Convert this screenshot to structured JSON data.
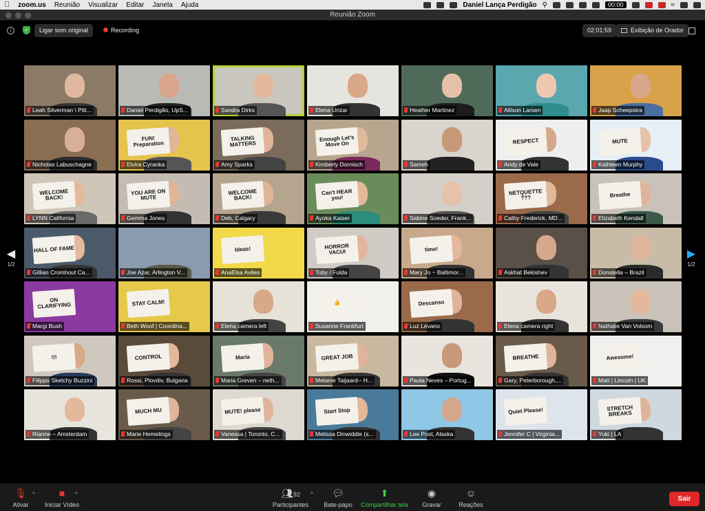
{
  "menubar": {
    "app": "zoom.us",
    "menus": [
      "Reunião",
      "Visualizar",
      "Editar",
      "Janela",
      "Ajuda"
    ],
    "user": "Daniel Lança Perdigão",
    "clock": "00:00"
  },
  "window": {
    "title": "Reunião Zoom"
  },
  "topbar": {
    "audio_label": "Ligar som original",
    "recording_label": "Recording",
    "elapsed": "02:01:59",
    "view_label": "Exibição de Orador"
  },
  "pager": {
    "left": "1/2",
    "right": "1/2"
  },
  "participants": [
    {
      "name": "Leah Silverman \\ Pitt...",
      "bg": "#8a7a66",
      "skin": "#e0b8a0",
      "shirt": "#333",
      "sign": ""
    },
    {
      "name": "Daniel Perdigão, UpS...",
      "bg": "#b9b9b6",
      "skin": "#d9a58a",
      "shirt": "#222",
      "sign": ""
    },
    {
      "name": "Sandra Dirks",
      "bg": "#c9c6bd",
      "skin": "#e4b89a",
      "shirt": "#555",
      "sign": "",
      "active": true
    },
    {
      "name": "Elena Urizar",
      "bg": "#e6e4df",
      "skin": "#d8a888",
      "shirt": "#333",
      "sign": ""
    },
    {
      "name": "Heather Martinez",
      "bg": "#4f6a59",
      "skin": "#e5c0a8",
      "shirt": "#1c1c1c",
      "sign": ""
    },
    {
      "name": "Allison Larsen",
      "bg": "#5aa7b0",
      "skin": "#f0c8b0",
      "shirt": "#2d8d8f",
      "sign": ""
    },
    {
      "name": "Jaap Scheepstra",
      "bg": "#d9a24a",
      "skin": "#d9a88c",
      "shirt": "#4b6e9e",
      "sign": ""
    },
    {
      "name": "Nicholas Labuschagne",
      "bg": "#8a6e52",
      "skin": "#d8b09a",
      "shirt": "#2d2d2d",
      "sign": ""
    },
    {
      "name": "Elvira Cyranka",
      "bg": "#e6c34d",
      "skin": "#e2b49a",
      "shirt": "#555",
      "sign": "FUN! Preparation"
    },
    {
      "name": "Amy Sparks",
      "bg": "#7a6b5a",
      "skin": "#e2b49a",
      "shirt": "#444",
      "sign": "TALKING MATTERS"
    },
    {
      "name": "Kimberly Dornisch",
      "bg": "#b7a58e",
      "skin": "#e0b89a",
      "shirt": "#7a2a5a",
      "sign": "Enough Let's Move On"
    },
    {
      "name": "Sameh",
      "bg": "#d9d4cc",
      "skin": "#c99878",
      "shirt": "#222",
      "sign": ""
    },
    {
      "name": "Andy de Vale",
      "bg": "#eeeeee",
      "skin": "#d4a88c",
      "shirt": "#333",
      "sign": "RESPECT"
    },
    {
      "name": "Kathleen Murphy",
      "bg": "#e6eef6",
      "skin": "#e6c2aa",
      "shirt": "#2a4b8c",
      "sign": "MUTE"
    },
    {
      "name": "LYNN California",
      "bg": "#cfc6b8",
      "skin": "#e4b89a",
      "shirt": "#6a6a6a",
      "sign": "WELCOME BACK!"
    },
    {
      "name": "Gemma Jones",
      "bg": "#c4bcb3",
      "skin": "#e2b49a",
      "shirt": "#333",
      "sign": "YOU ARE ON MUTE"
    },
    {
      "name": "Deb, Calgary",
      "bg": "#b6a58e",
      "skin": "#e0b49a",
      "shirt": "#3a3a3a",
      "sign": "WELCOME BACK!"
    },
    {
      "name": "Ayoka Kaiser",
      "bg": "#6a8c5a",
      "skin": "#e4b89a",
      "shirt": "#2a8c7a",
      "sign": "Can't HEAR you!"
    },
    {
      "name": "Sabine Soeder, Frank...",
      "bg": "#d4cfc8",
      "skin": "#e6c2aa",
      "shirt": "#555",
      "sign": ""
    },
    {
      "name": "Cathy Frederick, MD...",
      "bg": "#9a6a4a",
      "skin": "#e0b89a",
      "shirt": "#444",
      "sign": "NETQUETTE ???"
    },
    {
      "name": "Elizabeth Kendall",
      "bg": "#c9c2b8",
      "skin": "#e0b49a",
      "shirt": "#3a5a4a",
      "sign": "Breathe"
    },
    {
      "name": "Gillian Cromhout Ca...",
      "bg": "#4a5a6a",
      "skin": "#e4b89a",
      "shirt": "#333",
      "sign": "HALL OF FAME"
    },
    {
      "name": "Joe Azar, Arlington V...",
      "bg": "#8a9cb0",
      "skin": "#8a9cb0",
      "shirt": "#5a5a48",
      "sign": ""
    },
    {
      "name": "AnaElsa Aviles",
      "bg": "#f2d94a",
      "skin": "#f2d94a",
      "shirt": "#f2d94a",
      "sign": "Ideas!"
    },
    {
      "name": "Toby / Fulda",
      "bg": "#d0cbc4",
      "skin": "#e2b49a",
      "shirt": "#444",
      "sign": "HORROR VACUI"
    },
    {
      "name": "Mary Jo  ~ Baltimor...",
      "bg": "#c9a98c",
      "skin": "#e4b89a",
      "shirt": "#333",
      "sign": "time!"
    },
    {
      "name": "Askhat Bekishev",
      "bg": "#5a5048",
      "skin": "#d4a88c",
      "shirt": "#333",
      "sign": ""
    },
    {
      "name": "Donatella – Brazil",
      "bg": "#c8bca8",
      "skin": "#e0b49a",
      "shirt": "#2a2a2a",
      "sign": ""
    },
    {
      "name": "Margi Bush",
      "bg": "#8a3aa0",
      "skin": "#8a3aa0",
      "shirt": "#8a3aa0",
      "sign": "ON CLARIFYING"
    },
    {
      "name": "Beth Woof | Coordina...",
      "bg": "#e6c84a",
      "skin": "#e6c84a",
      "shirt": "#e6c84a",
      "sign": "STAY CALM!"
    },
    {
      "name": "Elena camera left",
      "bg": "#e6e2d8",
      "skin": "#d8a888",
      "shirt": "#444",
      "sign": ""
    },
    {
      "name": "Susanne Frankfurt",
      "bg": "#f2f0ec",
      "skin": "#f2f0ec",
      "shirt": "#f2f0ec",
      "sign": "👍"
    },
    {
      "name": "Luz Lévano",
      "bg": "#9a6a4a",
      "skin": "#e0b49a",
      "shirt": "#333",
      "sign": "Descanso"
    },
    {
      "name": "Elena camera right",
      "bg": "#e8e4dc",
      "skin": "#d8a888",
      "shirt": "#333",
      "sign": ""
    },
    {
      "name": "Nathalie Van Volsom",
      "bg": "#c9c2b8",
      "skin": "#e4b89a",
      "shirt": "#3a3a3a",
      "sign": ""
    },
    {
      "name": "Filippo Sketchy Buzzini",
      "bg": "#cfc8be",
      "skin": "#d8a888",
      "shirt": "#2a3a5a",
      "sign": "!!!"
    },
    {
      "name": "Rossi, Plovdiv, Bulgaria",
      "bg": "#5a4a3a",
      "skin": "#e4b89a",
      "shirt": "#333",
      "sign": "CONTROL"
    },
    {
      "name": "Maria Greven – neth...",
      "bg": "#6a7a6a",
      "skin": "#e0b49a",
      "shirt": "#444",
      "sign": "Maria"
    },
    {
      "name": "Melanie Taljaard-- H...",
      "bg": "#c8b8a0",
      "skin": "#e0b49a",
      "shirt": "#333",
      "sign": "GREAT JOB"
    },
    {
      "name": "Paula Neves – Portug...",
      "bg": "#e8e4de",
      "skin": "#c99878",
      "shirt": "#111",
      "sign": ""
    },
    {
      "name": "Gary, Peterborough,...",
      "bg": "#6a5a4a",
      "skin": "#e0b49a",
      "shirt": "#333",
      "sign": "BREATHE"
    },
    {
      "name": "Matt | Lincoln | UK",
      "bg": "#f0f0ee",
      "skin": "#f0f0ee",
      "shirt": "#f0f0ee",
      "sign": "Awesome!"
    },
    {
      "name": "Rianne – Amsterdam",
      "bg": "#e8e4de",
      "skin": "#e4b89a",
      "shirt": "#333",
      "sign": ""
    },
    {
      "name": "Marie Hemelings",
      "bg": "#6a5a4a",
      "skin": "#e0b49a",
      "shirt": "#444",
      "sign": "MUCH MU"
    },
    {
      "name": "Vanessa | Toronto, C...",
      "bg": "#ddd8d0",
      "skin": "#e0b49a",
      "shirt": "#444",
      "sign": "MUTE! please"
    },
    {
      "name": "Melissa Dinwiddie (s...",
      "bg": "#4a7a9a",
      "skin": "#e4b89a",
      "shirt": "#333",
      "sign": "Start Stop"
    },
    {
      "name": "Lee Post, Alaska",
      "bg": "#8ec8e6",
      "skin": "#d4a88c",
      "shirt": "#333",
      "sign": ""
    },
    {
      "name": "Jennifer C | Virginia...",
      "bg": "#dde4ec",
      "skin": "#dde4ec",
      "shirt": "#dde4ec",
      "sign": "Quiet Please!"
    },
    {
      "name": "Yuki | LA",
      "bg": "#cfd8de",
      "skin": "#e0b49a",
      "shirt": "#333",
      "sign": "STRETCH BREAKS"
    }
  ],
  "toolbar": {
    "mute": "Ativar",
    "video": "Iniciar Vídeo",
    "participants": "Participantes",
    "participant_count": "92",
    "chat": "Bate-papo",
    "share": "Compartilhar tela",
    "record": "Gravar",
    "reactions": "Reações",
    "leave": "Sair"
  },
  "colors": {
    "active_speaker": "#b6d136",
    "leave": "#e02828",
    "share_green": "#3fd14a"
  }
}
